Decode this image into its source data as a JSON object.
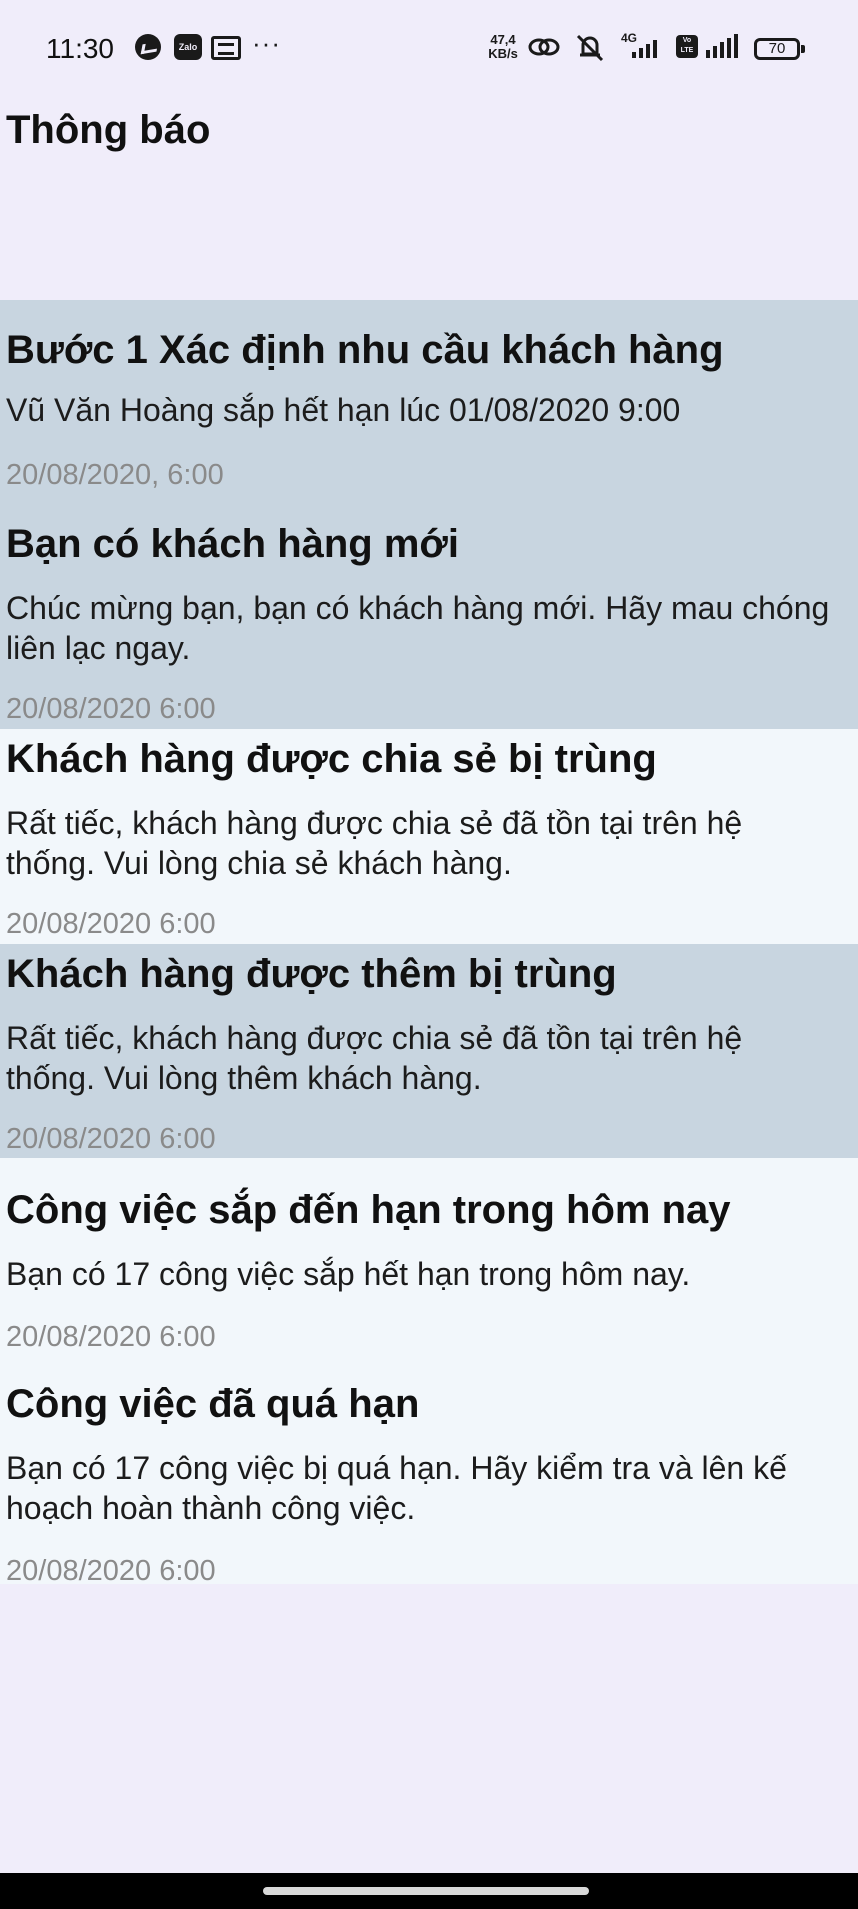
{
  "status_bar": {
    "time": "11:30",
    "network_speed_value": "47,4",
    "network_speed_unit": "KB/s",
    "network_type": "4G",
    "volte_label": "Vo LTE",
    "zalo_label": "Zalo",
    "more_label": "···",
    "battery": "70",
    "icons": [
      "messenger-icon",
      "zalo-icon",
      "contacts-icon",
      "more-icon",
      "link-icon",
      "mute-icon",
      "signal-icon",
      "volte-icon",
      "battery-icon"
    ]
  },
  "header": {
    "title": "Thông báo"
  },
  "notifications": [
    {
      "title": "Bước 1 Xác định nhu cầu khách hàng",
      "body": "Vũ Văn Hoàng sắp hết hạn lúc 01/08/2020 9:00",
      "time": "20/08/2020, 6:00",
      "read": false
    },
    {
      "title": "Bạn có khách hàng mới",
      "body": "Chúc mừng bạn, bạn có khách hàng mới. Hãy mau chóng liên lạc ngay.",
      "time": "20/08/2020 6:00",
      "read": false
    },
    {
      "title": "Khách hàng được chia sẻ bị trùng",
      "body": "Rất tiếc, khách hàng được chia sẻ đã tồn tại trên hệ thống. Vui lòng chia sẻ khách hàng.",
      "time": "20/08/2020 6:00",
      "read": true
    },
    {
      "title": "Khách hàng được thêm bị trùng",
      "body": "Rất tiếc, khách hàng được chia sẻ đã tồn tại trên hệ thống. Vui lòng thêm khách hàng.",
      "time": "20/08/2020 6:00",
      "read": false
    },
    {
      "title": "Công việc sắp đến hạn trong hôm nay",
      "body": "Bạn có 17 công việc sắp hết hạn trong hôm nay.",
      "time": "20/08/2020 6:00",
      "read": true
    },
    {
      "title": "Công việc đã quá hạn",
      "body": "Bạn có 17 công việc bị quá hạn. Hãy kiểm tra và lên kế hoạch hoàn thành công việc.",
      "time": "20/08/2020 6:00",
      "read": true
    }
  ],
  "colors": {
    "background": "#f0edfa",
    "unread_bg": "#c8d5e0",
    "read_bg": "#f2f7fb",
    "timestamp": "#8a8a8a"
  }
}
